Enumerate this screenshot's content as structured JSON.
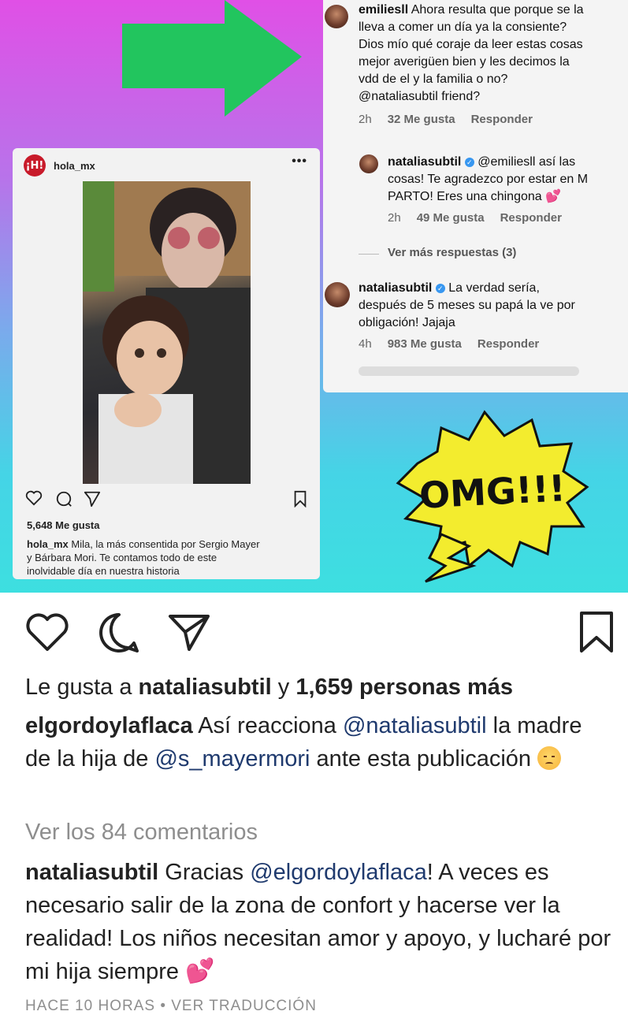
{
  "embedded_post": {
    "username": "hola_mx",
    "logo_text": "¡H!",
    "more": "•••",
    "likes": "5,648 Me gusta",
    "caption_user": "hola_mx",
    "caption_line1": " Mila, la más consentida por Sergio Mayer",
    "caption_line2": "y Bárbara Mori. Te contamos todo de este",
    "caption_line3": "inolvidable día en nuestra historia"
  },
  "comments": [
    {
      "user": "emiliesll",
      "lines": [
        " Ahora resulta que porque se la",
        "lleva a comer un día ya la consiente?",
        "Dios mío qué coraje da leer estas cosas",
        "mejor averigüen bien y les decimos la",
        "vdd de el y la familia o no?",
        "@nataliasubtil friend?"
      ],
      "time": "2h",
      "likes": "32 Me gusta",
      "reply": "Responder"
    },
    {
      "user": "nataliasubtil",
      "lines": [
        " @emiliesll así las",
        "cosas! Te agradezco por estar en M",
        "PARTO! Eres una chingona 💕"
      ],
      "time": "2h",
      "likes": "49 Me gusta",
      "reply": "Responder"
    },
    {
      "more_replies": "Ver más respuestas (3)"
    },
    {
      "user": "nataliasubtil",
      "lines": [
        " La verdad sería,",
        "después de 5 meses su papá la ve por",
        "obligación! Jajaja"
      ],
      "time": "4h",
      "likes": "983 Me gusta",
      "reply": "Responder"
    }
  ],
  "omg_text": "OMG!!!",
  "post": {
    "liked_by_prefix": "Le gusta a ",
    "liked_by_user": "nataliasubtil",
    "liked_by_mid": " y ",
    "liked_by_count": "1,659 personas más",
    "caption_user": "elgordoylaflaca",
    "caption_text1": " Así reacciona ",
    "caption_mention1": "@nataliasubtil",
    "caption_text2": " la madre de la hija de ",
    "caption_mention2": "@s_mayermori",
    "caption_text3": " ante esta publicación ",
    "view_comments": "Ver los 84 comentarios",
    "comment_user": "nataliasubtil",
    "comment_text1": " Gracias ",
    "comment_mention": "@elgordoylaflaca",
    "comment_text2": "! A veces es necesario salir de la zona de confort y hacerse ver la realidad! Los niños necesitan amor y apoyo, y lucharé por mi hija siempre ",
    "comment_emoji": "💕",
    "timestamp": "HACE 10 HORAS • VER TRADUCCIÓN"
  },
  "icons": {
    "like": "heart-icon",
    "comment": "comment-icon",
    "share": "share-icon",
    "save": "bookmark-icon"
  },
  "colors": {
    "arrow_green": "#22c55e",
    "omg_yellow": "#f3ec2e",
    "mention_blue": "#1f3a6e"
  }
}
